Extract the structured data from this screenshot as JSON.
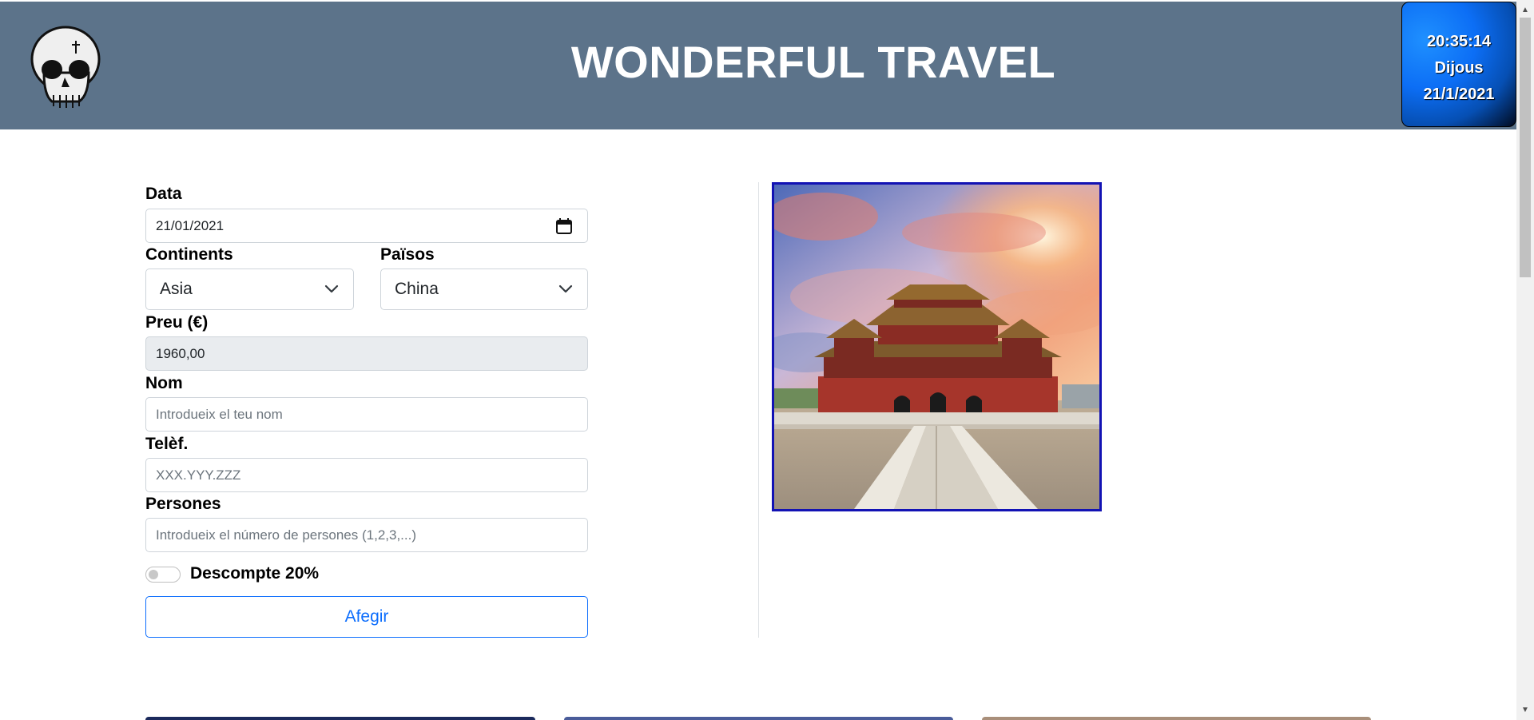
{
  "header": {
    "title": "WONDERFUL TRAVEL",
    "clock": {
      "time": "20:35:14",
      "day": "Dijous",
      "date": "21/1/2021"
    }
  },
  "form": {
    "date": {
      "label": "Data",
      "value": "21/01/2021"
    },
    "continent": {
      "label": "Continents",
      "value": "Asia"
    },
    "country": {
      "label": "Països",
      "value": "China"
    },
    "price": {
      "label": "Preu (€)",
      "value": "1960,00"
    },
    "name": {
      "label": "Nom",
      "placeholder": "Introdueix el teu nom"
    },
    "phone": {
      "label": "Telèf.",
      "placeholder": "XXX.YYY.ZZZ"
    },
    "people": {
      "label": "Persones",
      "placeholder": "Introdueix el número de persones (1,2,3,...)"
    },
    "discount": {
      "label": "Descompte 20%",
      "checked": false
    },
    "submit_label": "Afegir"
  },
  "colors": {
    "header_bg": "#5c738a",
    "accent": "#0d6efd",
    "photo_border": "#1212b4"
  },
  "icons": {
    "logo": "skull-icon",
    "date": "calendar-icon",
    "select": "chevron-down-icon"
  }
}
